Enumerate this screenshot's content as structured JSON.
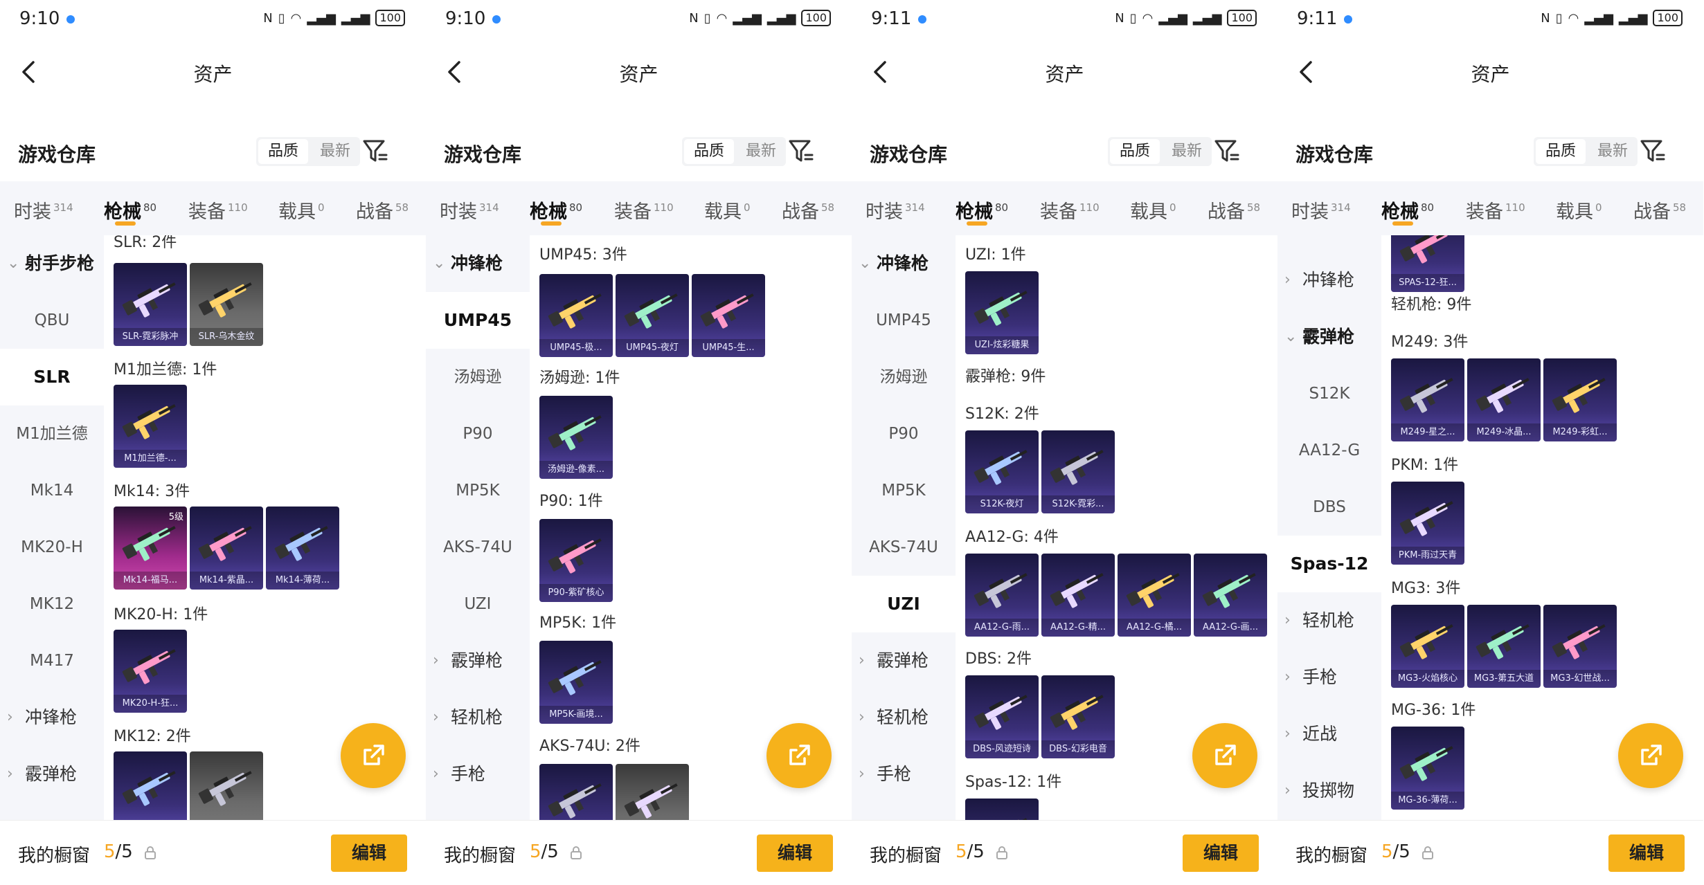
{
  "status": {
    "times": [
      "9:10",
      "9:10",
      "9:11",
      "9:11"
    ],
    "battery": "100"
  },
  "header": {
    "title": "资产"
  },
  "section": {
    "title": "游戏仓库",
    "sort_quality": "品质",
    "sort_latest": "最新"
  },
  "tabs": [
    {
      "label": "时装",
      "count": "314"
    },
    {
      "label": "枪械",
      "count": "80"
    },
    {
      "label": "装备",
      "count": "110"
    },
    {
      "label": "载具",
      "count": "0"
    },
    {
      "label": "战备",
      "count": "58"
    }
  ],
  "bottom": {
    "label": "我的橱窗",
    "count_current": "5",
    "count_total": "/5",
    "edit": "编辑"
  },
  "colors": {
    "accent": "#f6a623",
    "button": "#f6b21b",
    "skin_purple": "#3a2f78",
    "skin_pink": "#a02b8c",
    "skin_gray": "#6a6a6a"
  },
  "panels": [
    {
      "sidebar": [
        {
          "label": "射手步枪",
          "type": "group",
          "open": true
        },
        {
          "label": "QBU",
          "type": "item"
        },
        {
          "label": "SLR",
          "type": "item",
          "active": true
        },
        {
          "label": "M1加兰德",
          "type": "item"
        },
        {
          "label": "Mk14",
          "type": "item"
        },
        {
          "label": "MK20-H",
          "type": "item"
        },
        {
          "label": "MK12",
          "type": "item"
        },
        {
          "label": "M417",
          "type": "item"
        },
        {
          "label": "冲锋枪",
          "type": "group"
        },
        {
          "label": "霰弹枪",
          "type": "group"
        }
      ],
      "content": [
        {
          "label": "SLR: 2件",
          "skins": [
            {
              "name": "SLR-霓彩脉冲",
              "style": "purple"
            },
            {
              "name": "SLR-乌木金纹",
              "style": "gray"
            }
          ]
        },
        {
          "label": "M1加兰德: 1件",
          "skins": [
            {
              "name": "M1加兰德-...",
              "style": "purple"
            }
          ]
        },
        {
          "label": "Mk14: 3件",
          "skins": [
            {
              "name": "Mk14-福马...",
              "style": "pink",
              "badge": "5级"
            },
            {
              "name": "Mk14-紫晶...",
              "style": "purple"
            },
            {
              "name": "Mk14-薄荷...",
              "style": "purple"
            }
          ]
        },
        {
          "label": "MK20-H: 1件",
          "skins": [
            {
              "name": "MK20-H-狂...",
              "style": "purple"
            }
          ]
        },
        {
          "label": "MK12: 2件",
          "skins": [
            {
              "name": "",
              "style": "purple"
            },
            {
              "name": "",
              "style": "gray"
            }
          ]
        }
      ]
    },
    {
      "sidebar": [
        {
          "label": "冲锋枪",
          "type": "group",
          "open": true
        },
        {
          "label": "UMP45",
          "type": "item",
          "active": true
        },
        {
          "label": "汤姆逊",
          "type": "item"
        },
        {
          "label": "P90",
          "type": "item"
        },
        {
          "label": "MP5K",
          "type": "item"
        },
        {
          "label": "AKS-74U",
          "type": "item"
        },
        {
          "label": "UZI",
          "type": "item"
        },
        {
          "label": "霰弹枪",
          "type": "group"
        },
        {
          "label": "轻机枪",
          "type": "group"
        },
        {
          "label": "手枪",
          "type": "group"
        }
      ],
      "content": [
        {
          "label": "UMP45: 3件",
          "skins": [
            {
              "name": "UMP45-极...",
              "style": "purple"
            },
            {
              "name": "UMP45-夜灯",
              "style": "purple"
            },
            {
              "name": "UMP45-生...",
              "style": "purple"
            }
          ]
        },
        {
          "label": "汤姆逊: 1件",
          "skins": [
            {
              "name": "汤姆逊-像素...",
              "style": "purple"
            }
          ]
        },
        {
          "label": "P90: 1件",
          "skins": [
            {
              "name": "P90-紫矿核心",
              "style": "purple"
            }
          ]
        },
        {
          "label": "MP5K: 1件",
          "skins": [
            {
              "name": "MP5K-画境...",
              "style": "purple"
            }
          ]
        },
        {
          "label": "AKS-74U: 2件",
          "skins": [
            {
              "name": "",
              "style": "purple"
            },
            {
              "name": "",
              "style": "gray"
            }
          ]
        }
      ]
    },
    {
      "sidebar": [
        {
          "label": "冲锋枪",
          "type": "group",
          "open": true
        },
        {
          "label": "UMP45",
          "type": "item"
        },
        {
          "label": "汤姆逊",
          "type": "item"
        },
        {
          "label": "P90",
          "type": "item"
        },
        {
          "label": "MP5K",
          "type": "item"
        },
        {
          "label": "AKS-74U",
          "type": "item"
        },
        {
          "label": "UZI",
          "type": "item",
          "active": true
        },
        {
          "label": "霰弹枪",
          "type": "group"
        },
        {
          "label": "轻机枪",
          "type": "group"
        },
        {
          "label": "手枪",
          "type": "group"
        }
      ],
      "content": [
        {
          "label": "UZI: 1件",
          "skins": [
            {
              "name": "UZI-炫彩糖果",
              "style": "purple"
            }
          ]
        },
        {
          "label": "霰弹枪: 9件",
          "skins": []
        },
        {
          "label": "S12K: 2件",
          "skins": [
            {
              "name": "S12K-夜灯",
              "style": "purple"
            },
            {
              "name": "S12K-霓彩...",
              "style": "purple"
            }
          ]
        },
        {
          "label": "AA12-G: 4件",
          "skins": [
            {
              "name": "AA12-G-雨...",
              "style": "purple"
            },
            {
              "name": "AA12-G-精...",
              "style": "purple"
            },
            {
              "name": "AA12-G-橘...",
              "style": "purple"
            },
            {
              "name": "AA12-G-画...",
              "style": "purple"
            }
          ]
        },
        {
          "label": "DBS: 2件",
          "skins": [
            {
              "name": "DBS-风迹短诗",
              "style": "purple"
            },
            {
              "name": "DBS-幻彩电音",
              "style": "purple"
            }
          ]
        },
        {
          "label": "Spas-12: 1件",
          "skins": [
            {
              "name": "",
              "style": "purple"
            }
          ]
        }
      ]
    },
    {
      "sidebar": [
        {
          "label": "冲锋枪",
          "type": "group"
        },
        {
          "label": "霰弹枪",
          "type": "group",
          "open": true
        },
        {
          "label": "S12K",
          "type": "item"
        },
        {
          "label": "AA12-G",
          "type": "item"
        },
        {
          "label": "DBS",
          "type": "item"
        },
        {
          "label": "Spas-12",
          "type": "item",
          "active": true
        },
        {
          "label": "轻机枪",
          "type": "group"
        },
        {
          "label": "手枪",
          "type": "group"
        },
        {
          "label": "近战",
          "type": "group"
        },
        {
          "label": "投掷物",
          "type": "group"
        }
      ],
      "content": [
        {
          "label": "",
          "skins": [
            {
              "name": "SPAS-12-狂...",
              "style": "purple"
            }
          ]
        },
        {
          "label": "轻机枪: 9件",
          "skins": []
        },
        {
          "label": "M249: 3件",
          "skins": [
            {
              "name": "M249-星之...",
              "style": "purple"
            },
            {
              "name": "M249-冰晶...",
              "style": "purple"
            },
            {
              "name": "M249-彩虹...",
              "style": "purple"
            }
          ]
        },
        {
          "label": "PKM: 1件",
          "skins": [
            {
              "name": "PKM-雨过天青",
              "style": "purple"
            }
          ]
        },
        {
          "label": "MG3: 3件",
          "skins": [
            {
              "name": "MG3-火焰核心",
              "style": "purple"
            },
            {
              "name": "MG3-第五大道",
              "style": "purple"
            },
            {
              "name": "MG3-幻世战...",
              "style": "purple"
            }
          ]
        },
        {
          "label": "MG-36: 1件",
          "skins": [
            {
              "name": "MG-36-薄荷...",
              "style": "purple"
            }
          ]
        }
      ]
    }
  ]
}
